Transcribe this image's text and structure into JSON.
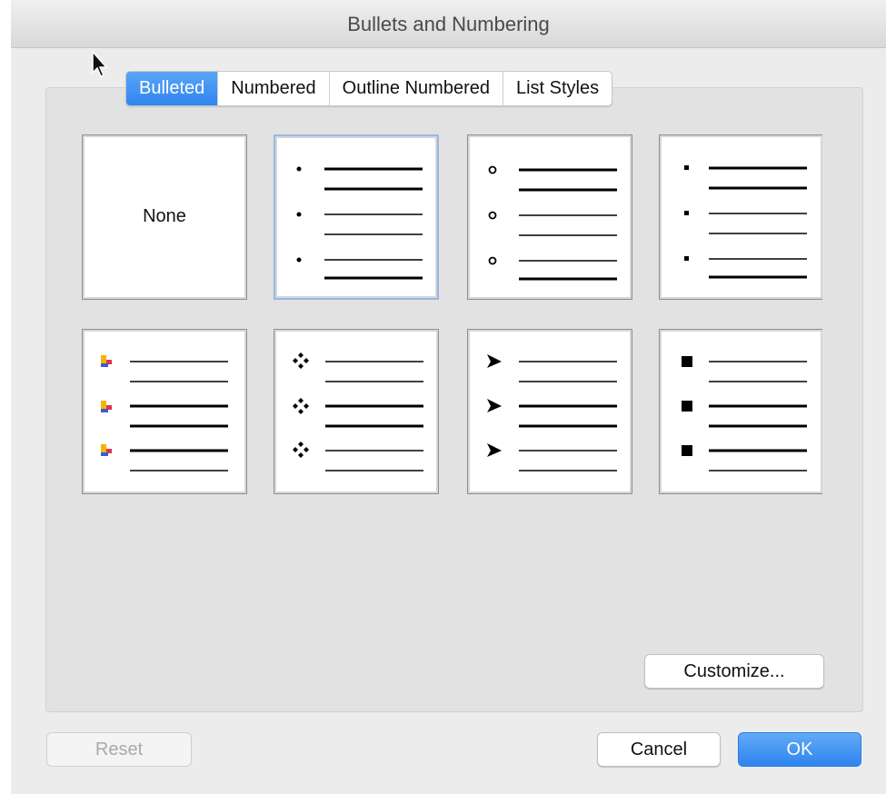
{
  "window": {
    "title": "Bullets and Numbering"
  },
  "tabs": [
    {
      "label": "Bulleted",
      "active": true
    },
    {
      "label": "Numbered",
      "active": false
    },
    {
      "label": "Outline Numbered",
      "active": false
    },
    {
      "label": "List Styles",
      "active": false
    }
  ],
  "gallery": {
    "none_label": "None",
    "selected_index": 1,
    "styles": [
      "none",
      "small-dot",
      "hollow-circle",
      "small-square",
      "picture-bullet",
      "four-diamond",
      "arrowhead",
      "filled-square"
    ]
  },
  "buttons": {
    "customize": "Customize...",
    "reset": "Reset",
    "cancel": "Cancel",
    "ok": "OK"
  },
  "colors": {
    "accent": "#2f86ef",
    "selection": "#98b8e2"
  }
}
